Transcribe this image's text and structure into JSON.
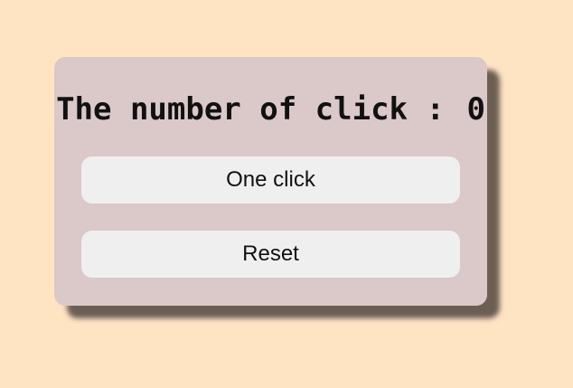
{
  "counter": {
    "label": "The number of click :",
    "value": "0"
  },
  "buttons": {
    "one_click_label": "One click",
    "reset_label": "Reset"
  },
  "colors": {
    "background": "#ffe4c4",
    "card": "#dbc8c8",
    "button": "#efefef",
    "shadow": "#5a4e48"
  }
}
